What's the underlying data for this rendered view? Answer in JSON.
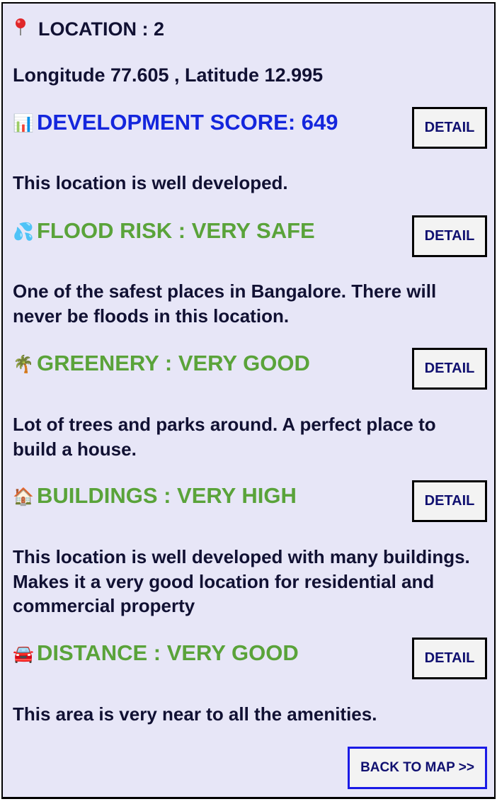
{
  "location": {
    "title": "LOCATION : 2",
    "coordinates": "Longitude 77.605 , Latitude 12.995"
  },
  "sections": [
    {
      "icon": "📊",
      "icon_name": "bar-chart-icon",
      "heading": "DEVELOPMENT SCORE: 649",
      "description": "This location is well developed.",
      "button_label": "DETAIL"
    },
    {
      "icon": "💦",
      "icon_name": "sweat-droplets-icon",
      "heading": "FLOOD RISK : VERY SAFE",
      "description": "One of the safest places in Bangalore. There will never be floods in this location.",
      "button_label": "DETAIL"
    },
    {
      "icon": "🌴",
      "icon_name": "palm-tree-icon",
      "heading": "GREENERY : VERY GOOD",
      "description": "Lot of trees and parks around. A perfect place to build a house.",
      "button_label": "DETAIL"
    },
    {
      "icon": "🏠",
      "icon_name": "house-icon",
      "heading": "BUILDINGS : VERY HIGH",
      "description": "This location is well developed with many buildings. Makes it a very good location for residential and commercial property",
      "button_label": "DETAIL"
    },
    {
      "icon": "🚘",
      "icon_name": "car-icon",
      "heading": "DISTANCE : VERY GOOD",
      "description": "This area is very near to all the amenities.",
      "button_label": "DETAIL"
    }
  ],
  "back_button": {
    "label": "BACK TO MAP >>"
  },
  "colors": {
    "panel_background": "#e7e6f7",
    "development_heading": "#1426dd",
    "rating_heading": "#5aa33a",
    "body_text": "#111133",
    "back_button_border": "#1a1ae6"
  }
}
